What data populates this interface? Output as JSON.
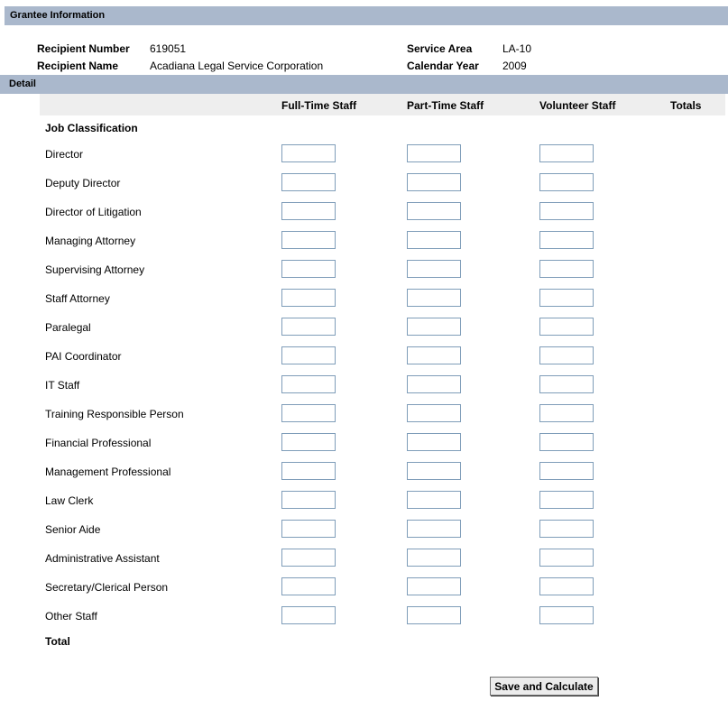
{
  "sections": {
    "grantee": "Grantee Information",
    "detail": "Detail"
  },
  "grantee": {
    "recipient_number_label": "Recipient Number",
    "recipient_number": "619051",
    "recipient_name_label": "Recipient Name",
    "recipient_name": "Acadiana Legal Service Corporation",
    "service_area_label": "Service Area",
    "service_area": "LA-10",
    "calendar_year_label": "Calendar Year",
    "calendar_year": "2009"
  },
  "columns": [
    "Full-Time Staff",
    "Part-Time Staff",
    "Volunteer Staff",
    "Totals"
  ],
  "job_classification_label": "Job Classification",
  "rows": [
    "Director",
    "Deputy Director",
    "Director of Litigation",
    "Managing Attorney",
    "Supervising Attorney",
    "Staff Attorney",
    "Paralegal",
    "PAI Coordinator",
    "IT Staff",
    "Training Responsible Person",
    "Financial Professional",
    "Management Professional",
    "Law Clerk",
    "Senior Aide",
    "Administrative Assistant",
    "Secretary/Clerical Person",
    "Other Staff"
  ],
  "total_label": "Total",
  "save_button": "Save and Calculate"
}
